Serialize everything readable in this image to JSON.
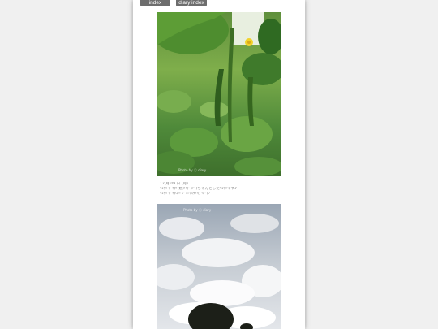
{
  "nav": {
    "index_label": "index",
    "diary_index_label": "diary index"
  },
  "entry": {
    "date": "12 月 09 日 (月)",
    "caption_line1": "ｷｭｳﾘ ﾃﾞｷﾀ!(嬉)!!(ﾟ∀ﾟ)ちゃんとしたｷｭｳﾘです♪",
    "caption_line2": "ｷｭｳﾘ ﾃﾞｷﾀﾖ!! ｼﾞｭﾝﾁｮｳ!!(ﾟ∀ﾟ)ﾉ"
  },
  "photos": [
    {
      "subject": "cucumber plant with yellow flower",
      "watermark": "Photo by ⓒ diary"
    },
    {
      "subject": "cloudy sky above tree silhouette",
      "watermark": "Photo by ⓒ diary"
    }
  ],
  "colors": {
    "page_bg": "#f0f0f0",
    "content_bg": "#ffffff",
    "nav_button": "#6d6d6d",
    "caption_text": "#8a8a8a"
  }
}
